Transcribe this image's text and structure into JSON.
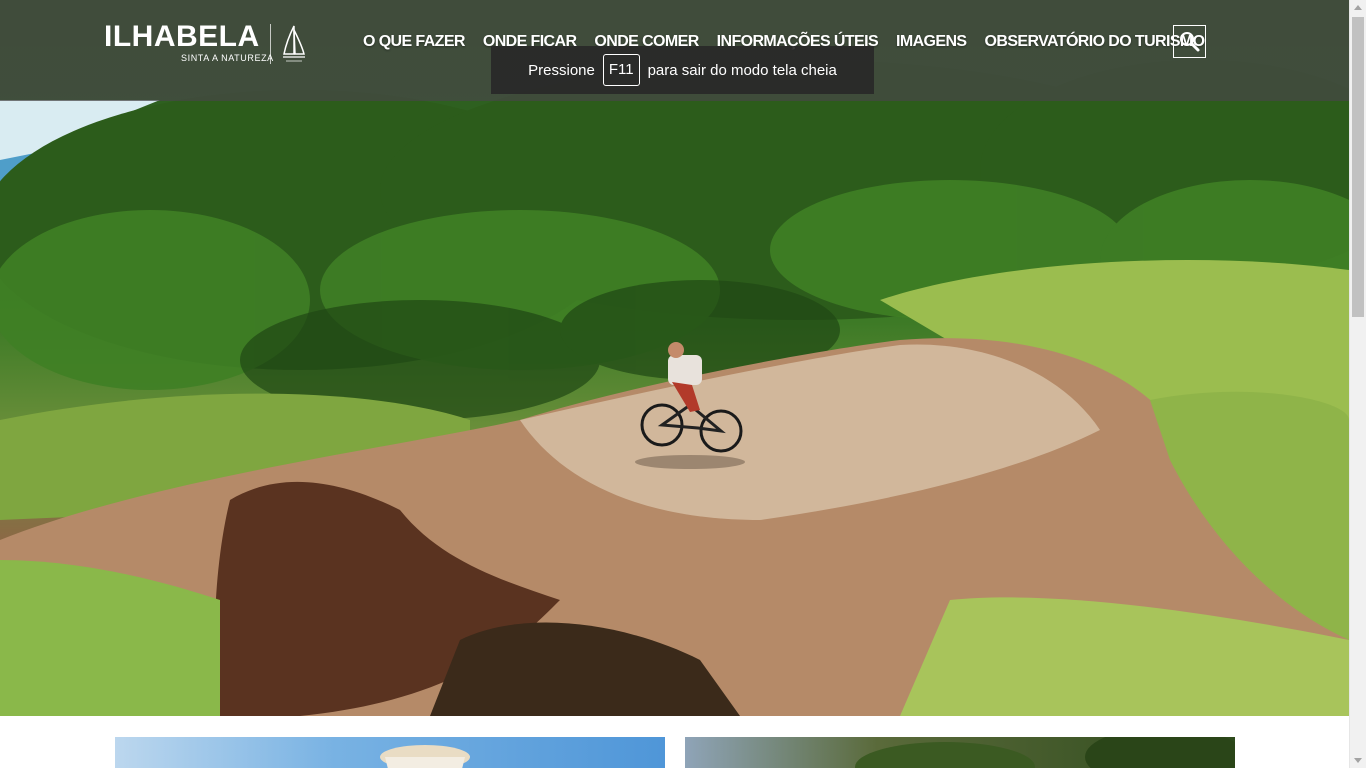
{
  "header": {
    "logo": {
      "name": "ILHABELA",
      "tagline": "SINTA A NATUREZA"
    },
    "nav": [
      {
        "label": "O QUE FAZER"
      },
      {
        "label": "ONDE FICAR"
      },
      {
        "label": "ONDE COMER"
      },
      {
        "label": "INFORMAÇÕES ÚTEIS"
      },
      {
        "label": "IMAGENS"
      },
      {
        "label": "OBSERVATÓRIO DO TURISMO"
      }
    ],
    "search_icon": "search-icon"
  },
  "fullscreen_toast": {
    "prefix": "Pressione",
    "key": "F11",
    "suffix": "para sair do modo tela cheia"
  },
  "hero": {
    "image": "mountain-biker-on-rock-outcrop-in-forest"
  },
  "cards": [
    {
      "image": "beach-scene-card"
    },
    {
      "image": "forest-scene-card"
    }
  ],
  "colors": {
    "header_overlay": "#464646",
    "text": "#ffffff",
    "scrollbar_track": "#f1f1f1",
    "scrollbar_thumb": "#c1c1c1"
  }
}
